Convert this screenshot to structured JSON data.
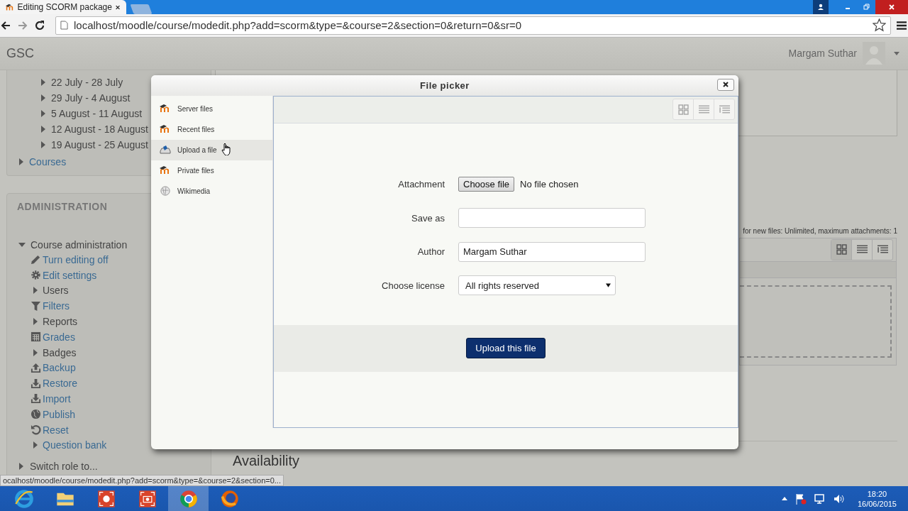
{
  "browser": {
    "tab_title": "Editing SCORM package",
    "url": "localhost/moodle/course/modedit.php?add=scorm&type=&course=2&section=0&return=0&sr=0"
  },
  "header": {
    "site_name": "GSC",
    "user_name": "Margam Suthar"
  },
  "navigation": {
    "weeks": [
      "22 July - 28 July",
      "29 July - 4 August",
      "5 August - 11 August",
      "12 August - 18 August",
      "19 August - 25 August"
    ],
    "courses_link": "Courses"
  },
  "administration": {
    "title": "ADMINISTRATION",
    "section": "Course administration",
    "expanded": true,
    "items": [
      {
        "label": "Turn editing off",
        "kind": "edit"
      },
      {
        "label": "Edit settings",
        "kind": "settings"
      },
      {
        "label": "Users",
        "kind": "branch"
      },
      {
        "label": "Filters",
        "kind": "filter"
      },
      {
        "label": "Reports",
        "kind": "branch"
      },
      {
        "label": "Grades",
        "kind": "grades"
      },
      {
        "label": "Badges",
        "kind": "branch"
      },
      {
        "label": "Backup",
        "kind": "backup"
      },
      {
        "label": "Restore",
        "kind": "restore"
      },
      {
        "label": "Import",
        "kind": "restore"
      },
      {
        "label": "Publish",
        "kind": "publish"
      },
      {
        "label": "Reset",
        "kind": "reset"
      },
      {
        "label": "Question bank",
        "kind": "branch-link"
      }
    ],
    "switch_role": "Switch role to..."
  },
  "main": {
    "files_note": "for new files: Unlimited, maximum attachments: 1",
    "availability_heading": "Availability"
  },
  "file_picker": {
    "title": "File picker",
    "repositories": [
      {
        "label": "Server files",
        "kind": "moodle",
        "selected": false
      },
      {
        "label": "Recent files",
        "kind": "moodle",
        "selected": false
      },
      {
        "label": "Upload a file",
        "kind": "upload",
        "selected": true
      },
      {
        "label": "Private files",
        "kind": "moodle",
        "selected": false
      },
      {
        "label": "Wikimedia",
        "kind": "wiki",
        "selected": false
      }
    ],
    "form": {
      "attachment_label": "Attachment",
      "choose_button": "Choose file",
      "no_file": "No file chosen",
      "save_as_label": "Save as",
      "author_label": "Author",
      "author_value": "Margam Suthar",
      "license_label": "Choose license",
      "license_value": "All rights reserved"
    },
    "upload_button": "Upload this file"
  },
  "status_url": "ocalhost/moodle/course/modedit.php?add=scorm&type=&course=2&section=0...",
  "taskbar": {
    "apps": [
      {
        "kind": "ie",
        "selected": false
      },
      {
        "kind": "folder",
        "selected": false
      },
      {
        "kind": "recorder",
        "selected": false
      },
      {
        "kind": "camera",
        "selected": false
      },
      {
        "kind": "chrome",
        "selected": true
      },
      {
        "kind": "firefox",
        "selected": false
      }
    ],
    "time": "18:20",
    "date": "16/06/2015"
  }
}
